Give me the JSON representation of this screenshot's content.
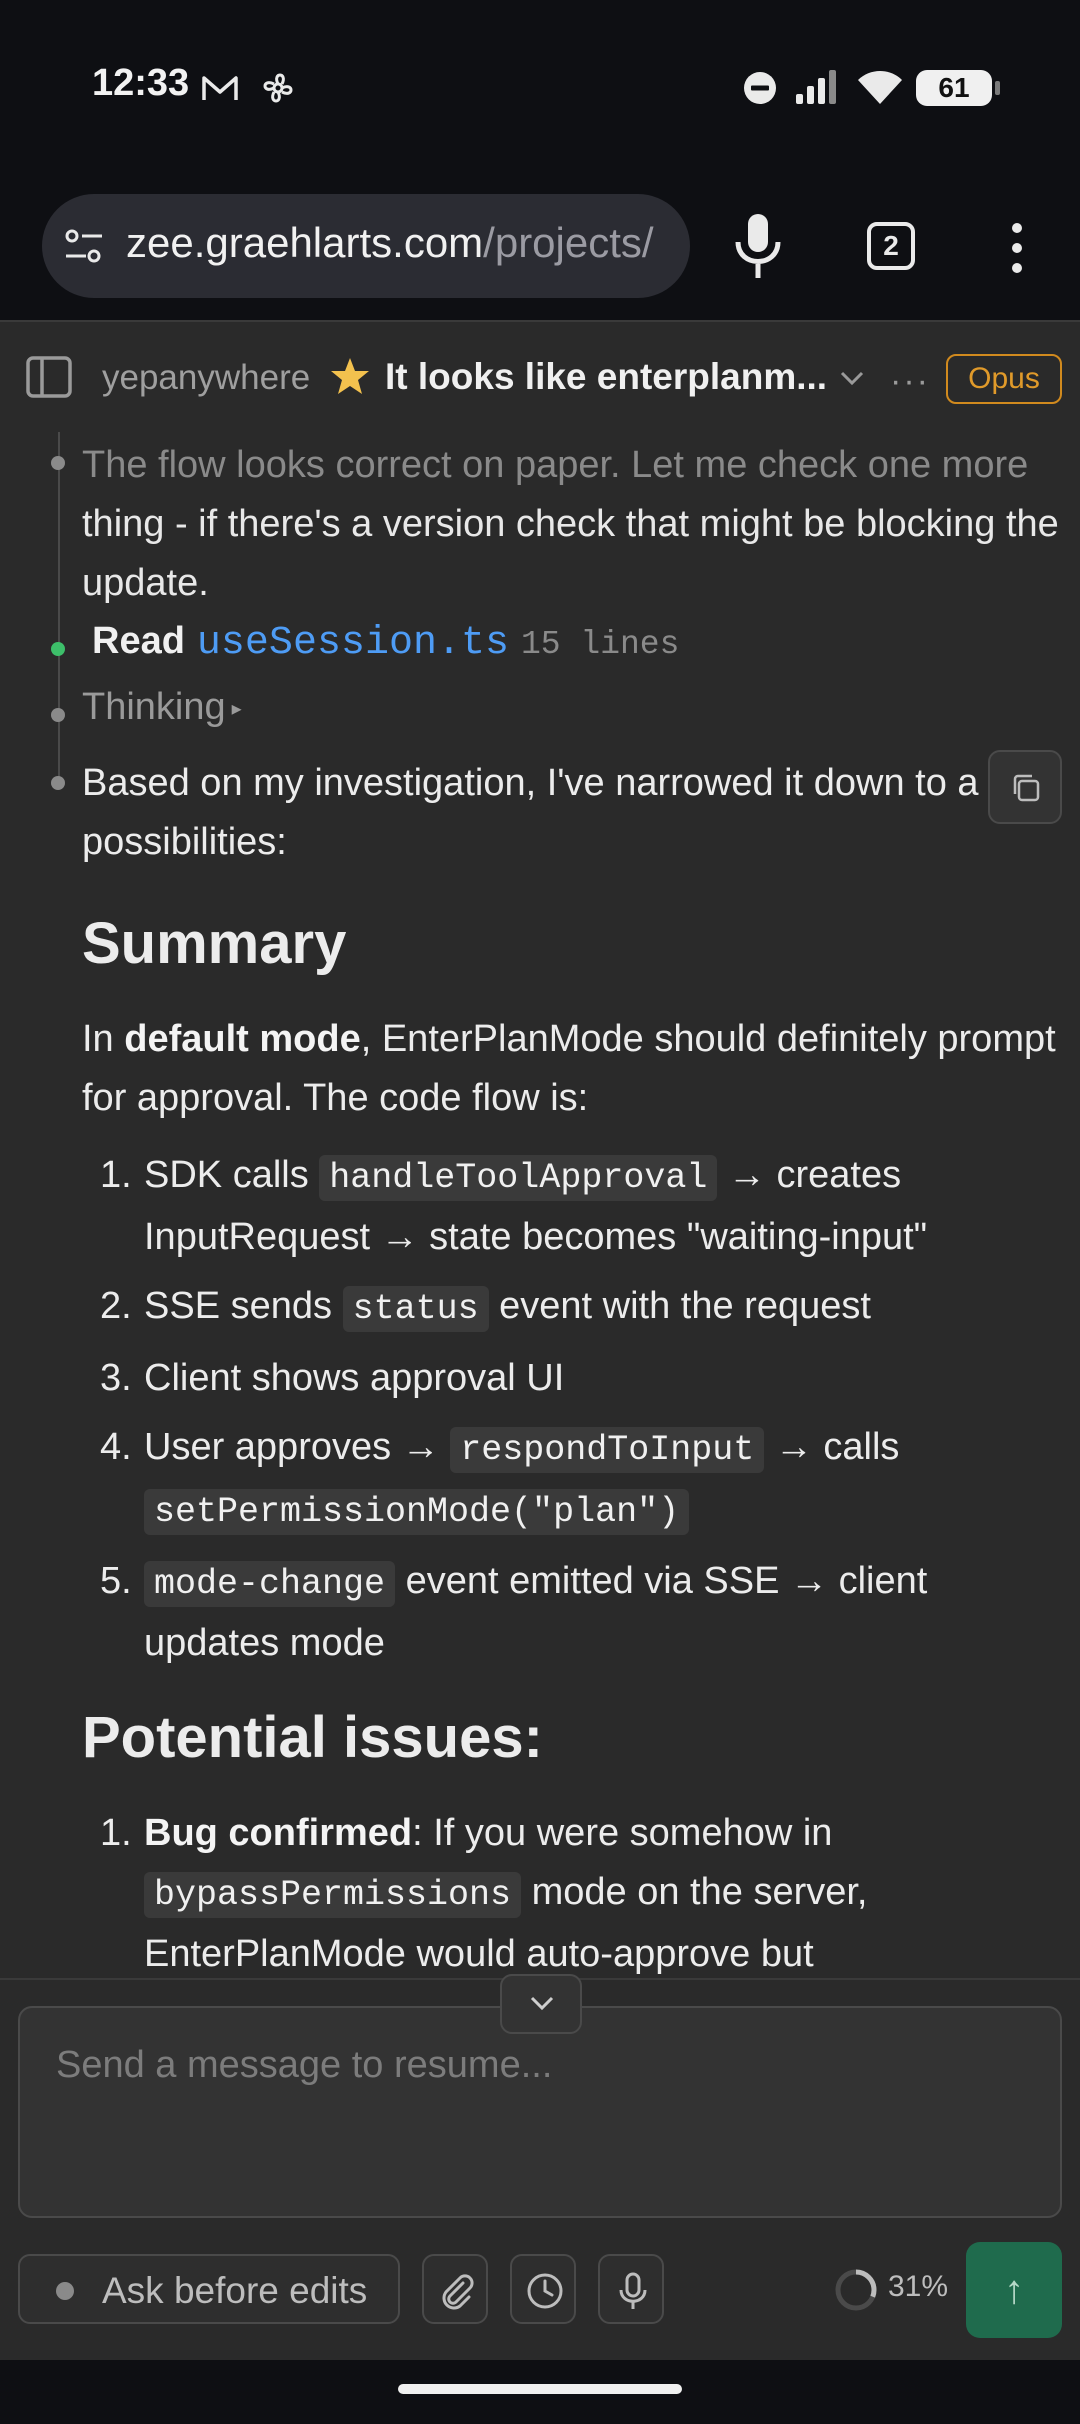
{
  "status_bar": {
    "time": "12:33",
    "battery": "61",
    "icons": [
      "gmail-icon",
      "pinwheel-icon",
      "do-not-disturb-icon",
      "signal-icon",
      "wifi-icon",
      "battery-icon"
    ]
  },
  "browser": {
    "url_host": "zee.graehlarts.com",
    "url_path": "/projects/",
    "tab_count": "2"
  },
  "header": {
    "project": "yepanywhere",
    "title": "It looks like enterplanm...",
    "more": "···",
    "model": "Opus"
  },
  "timeline": {
    "prev_message_l1": "The flow looks correct on paper. Let me check one more",
    "prev_message_l2": "thing - if there's a version check that might be blocking the update.",
    "read_label": "Read",
    "read_file": "useSession.ts",
    "read_lines": "15 lines",
    "thinking_label": "Thinking",
    "thinking_arrow": "▸"
  },
  "reply": {
    "intro": "Based on my investigation, I've narrowed it down to a few possibilities:",
    "summary_heading": "Summary",
    "summary_pre": "In ",
    "summary_bold": "default mode",
    "summary_post": ", EnterPlanMode should definitely prompt for approval. The code flow is:",
    "steps": [
      {
        "n": "1.",
        "a": "SDK calls ",
        "code": "handleToolApproval",
        "b": " → creates InputRequest → state becomes \"waiting-input\""
      },
      {
        "n": "2.",
        "a": "SSE sends ",
        "code": "status",
        "b": " event with the request"
      },
      {
        "n": "3.",
        "a": "Client shows approval UI"
      },
      {
        "n": "4.",
        "a": "User approves → ",
        "code": "respondToInput",
        "b": " → calls ",
        "code2": "setPermissionMode(\"plan\")"
      },
      {
        "n": "5.",
        "code": "mode-change",
        "b": " event emitted via SSE → client updates mode"
      }
    ],
    "issues_heading": "Potential issues:",
    "issues": [
      {
        "n": "1.",
        "bold": "Bug confirmed",
        "a": ": If you were somehow in ",
        "code": "bypassPermissions",
        "b": " mode on the server, EnterPlanMode would auto-approve but"
      }
    ]
  },
  "composer": {
    "placeholder": "Send a message to resume...",
    "mode_label": "Ask before edits",
    "context_percent": "31%",
    "context_fraction": 0.31,
    "send_glyph": "↑"
  },
  "colors": {
    "accent_blue": "#4e9cf5",
    "model_badge": "#e09a2a",
    "send_button": "#1f6b4d",
    "active_dot": "#3dbf6a"
  }
}
